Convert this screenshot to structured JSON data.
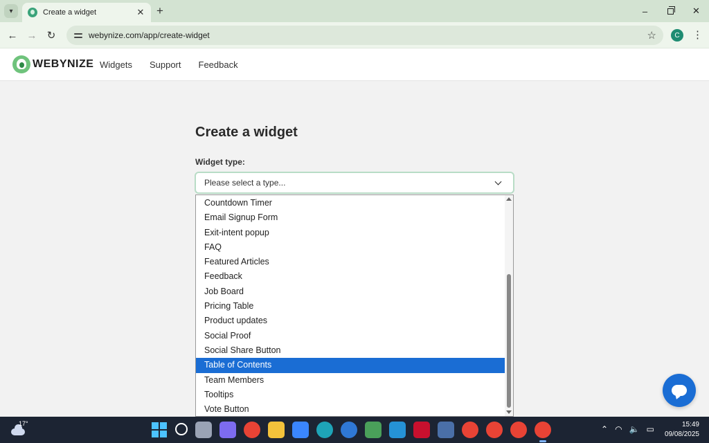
{
  "browser": {
    "tab_title": "Create a widget",
    "url": "webynize.com/app/create-widget",
    "profile_initial": "C",
    "window_controls": {
      "minimize": "–",
      "close": "✕"
    },
    "new_tab": "+",
    "tab_close": "✕"
  },
  "site": {
    "logo_text": "WEBYNIZE",
    "nav": [
      "Widgets",
      "Support",
      "Feedback"
    ]
  },
  "form": {
    "title": "Create a widget",
    "label": "Widget type:",
    "select_placeholder": "Please select a type...",
    "options": [
      "Countdown Timer",
      "Email Signup Form",
      "Exit-intent popup",
      "FAQ",
      "Featured Articles",
      "Feedback",
      "Job Board",
      "Pricing Table",
      "Product updates",
      "Social Proof",
      "Social Share Button",
      "Table of Contents",
      "Team Members",
      "Tooltips",
      "Vote Button"
    ],
    "highlighted_option": "Table of Contents"
  },
  "taskbar": {
    "temperature": "17°",
    "time": "15:49",
    "date": "09/08/2025",
    "apps": [
      {
        "name": "windows-start",
        "color": "#4cc2ff"
      },
      {
        "name": "search",
        "color": "#2b3447"
      },
      {
        "name": "task-view",
        "color": "#9aa3b5"
      },
      {
        "name": "copilot",
        "color": "#7d6bf0"
      },
      {
        "name": "chrome",
        "color": "#e84335"
      },
      {
        "name": "file-explorer",
        "color": "#f3c23b"
      },
      {
        "name": "microsoft-store",
        "color": "#3a86ff"
      },
      {
        "name": "edge",
        "color": "#1ea4b8"
      },
      {
        "name": "edge-dev",
        "color": "#2f78d6"
      },
      {
        "name": "app-green",
        "color": "#4aa05a"
      },
      {
        "name": "app-blue",
        "color": "#2592d6"
      },
      {
        "name": "mcafee",
        "color": "#c8102e"
      },
      {
        "name": "app-monitor",
        "color": "#4a6fa8"
      },
      {
        "name": "chrome-profile-1",
        "color": "#e84335"
      },
      {
        "name": "chrome-profile-2",
        "color": "#e84335"
      },
      {
        "name": "chrome-profile-3",
        "color": "#e84335"
      },
      {
        "name": "chrome-profile-4",
        "color": "#e84335"
      }
    ]
  },
  "colors": {
    "accent": "#1a6dd4",
    "brand_green": "#6fc37c",
    "select_border": "#b8dcc6"
  }
}
